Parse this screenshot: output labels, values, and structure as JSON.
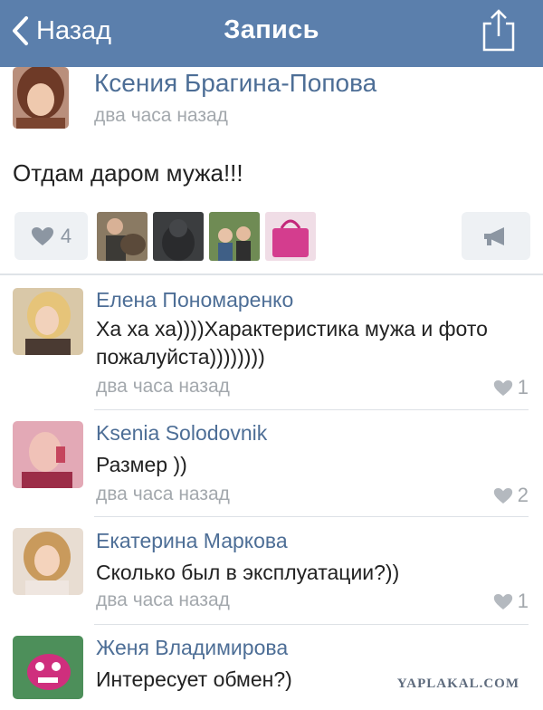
{
  "navbar": {
    "back_label": "Назад",
    "title": "Запись",
    "back_icon": "chevron-left-icon",
    "share_icon": "share-icon"
  },
  "post": {
    "author": "Ксения Брагина-Попова",
    "time": "два часа назад",
    "text": "Отдам даром мужа!!!",
    "likes": "4",
    "attachments": [
      "photo-man-dog",
      "photo-cat",
      "photo-couple",
      "photo-pink-bag"
    ]
  },
  "comments": [
    {
      "author": "Елена Пономаренко",
      "text": "Ха ха ха))))Характеристика мужа и фото пожалуйста))))))))",
      "time": "два часа назад",
      "likes": "1"
    },
    {
      "author": "Ksenia Solodovnik",
      "text": "Размер ))",
      "time": "два часа назад",
      "likes": "2"
    },
    {
      "author": "Екатерина Маркова",
      "text": "Сколько был в эксплуатации?))",
      "time": "два часа назад",
      "likes": "1"
    },
    {
      "author": "Женя Владимирова",
      "text": "Интересует обмен?)"
    }
  ],
  "watermark": "YAPLAKAL.COM",
  "colors": {
    "navbar": "#5b7fac",
    "author": "#4d6e96",
    "time": "#a3a8ad"
  }
}
